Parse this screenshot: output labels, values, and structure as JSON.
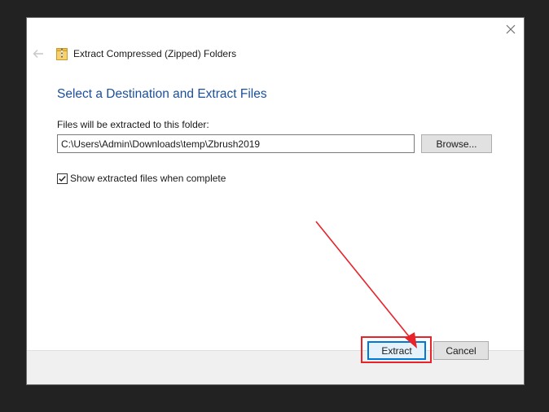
{
  "window": {
    "title": "Extract Compressed (Zipped) Folders"
  },
  "main": {
    "heading": "Select a Destination and Extract Files",
    "path_label": "Files will be extracted to this folder:",
    "path_value": "C:\\Users\\Admin\\Downloads\\temp\\Zbrush2019",
    "browse_label": "Browse...",
    "show_files_label": "Show extracted files when complete",
    "show_files_checked": true
  },
  "footer": {
    "extract_label": "Extract",
    "cancel_label": "Cancel"
  },
  "colors": {
    "heading": "#1b4f9c",
    "annotation": "#e8232a",
    "default_button_border": "#0078d7"
  },
  "icons": {
    "close": "close-icon",
    "back": "back-arrow-icon",
    "zip": "zip-folder-icon",
    "check": "checkmark-icon"
  }
}
